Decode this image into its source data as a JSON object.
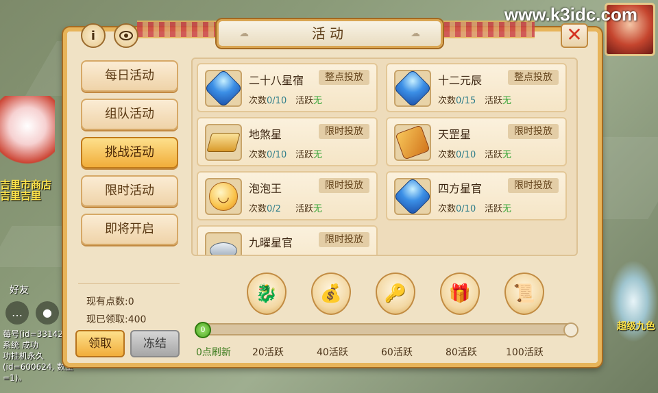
{
  "watermark": "www.k3idc.com",
  "title": "活动",
  "side_menu": [
    {
      "label": "每日活动",
      "active": false
    },
    {
      "label": "组队活动",
      "active": false
    },
    {
      "label": "挑战活动",
      "active": true
    },
    {
      "label": "限时活动",
      "active": false
    },
    {
      "label": "即将开启",
      "active": false
    }
  ],
  "points": {
    "current_label": "现有点数:",
    "current_value": "0",
    "claimed_label": "现已领取:",
    "claimed_value": "400"
  },
  "buttons": {
    "claim": "领取",
    "freeze": "冻结",
    "info": "i",
    "close": "✕"
  },
  "activities": [
    {
      "name": "二十八星宿",
      "tag": "整点投放",
      "count_label": "次数",
      "count": "0/10",
      "active_label": "活跃",
      "active_value": "无",
      "icon": "blue-gem-icon"
    },
    {
      "name": "十二元辰",
      "tag": "整点投放",
      "count_label": "次数",
      "count": "0/15",
      "active_label": "活跃",
      "active_value": "无",
      "icon": "blue-gem-icon"
    },
    {
      "name": "地煞星",
      "tag": "限时投放",
      "count_label": "次数",
      "count": "0/10",
      "active_label": "活跃",
      "active_value": "无",
      "icon": "gold-block-icon"
    },
    {
      "name": "天罡星",
      "tag": "限时投放",
      "count_label": "次数",
      "count": "0/10",
      "active_label": "活跃",
      "active_value": "无",
      "icon": "scroll-icon"
    },
    {
      "name": "泡泡王",
      "tag": "限时投放",
      "count_label": "次数",
      "count": "0/2",
      "active_label": "活跃",
      "active_value": "无",
      "icon": "bubble-face-icon"
    },
    {
      "name": "四方星官",
      "tag": "限时投放",
      "count_label": "次数",
      "count": "0/10",
      "active_label": "活跃",
      "active_value": "无",
      "icon": "blue-gem-icon"
    },
    {
      "name": "九曜星官",
      "tag": "限时投放",
      "icon": "silver-item-icon"
    }
  ],
  "rewards": [
    {
      "icon": "dragon-pet-icon"
    },
    {
      "icon": "treasure-pile-icon"
    },
    {
      "icon": "key-icon"
    },
    {
      "icon": "gift-bag-icon"
    },
    {
      "icon": "scroll-reward-icon"
    }
  ],
  "progress": {
    "value": 0,
    "knob_label": "0",
    "ticks": [
      "0点刷新",
      "20活跃",
      "40活跃",
      "60活跃",
      "80活跃",
      "100活跃"
    ]
  },
  "background": {
    "shop_label_1": "吉里市商店",
    "shop_label_2": "吉里吉里",
    "friend_label": "好友",
    "chat_lines": [
      "莓号(id=33142",
      "系统 成功",
      "功挂机永久(id=600624, 数量=1)。"
    ],
    "right_label": "超级九色"
  },
  "colors": {
    "accent": "#f1ad3a",
    "active_value": "#3aa63a",
    "count_value": "#2e7d8a",
    "close": "#d43222"
  }
}
